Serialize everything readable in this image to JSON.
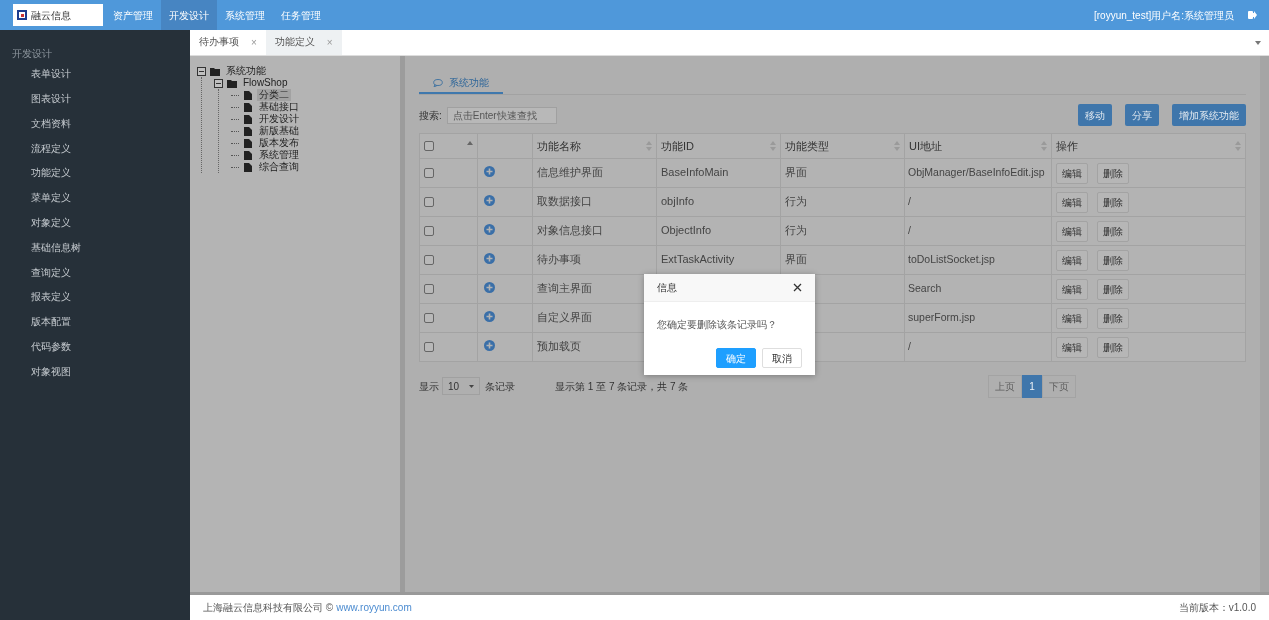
{
  "header": {
    "logo_text": "融云信息",
    "nav": [
      {
        "label": "资产管理",
        "selected": false
      },
      {
        "label": "开发设计",
        "selected": true
      },
      {
        "label": "系统管理",
        "selected": false
      },
      {
        "label": "任务管理",
        "selected": false
      }
    ],
    "user": "[royyun_test]用户名:系统管理员"
  },
  "sidebar": {
    "heading": "开发设计",
    "items": [
      {
        "label": "表单设计"
      },
      {
        "label": "图表设计"
      },
      {
        "label": "文档资料"
      },
      {
        "label": "流程定义"
      },
      {
        "label": "功能定义"
      },
      {
        "label": "菜单定义"
      },
      {
        "label": "对象定义"
      },
      {
        "label": "基础信息树"
      },
      {
        "label": "查询定义"
      },
      {
        "label": "报表定义"
      },
      {
        "label": "版本配置"
      },
      {
        "label": "代码参数"
      },
      {
        "label": "对象视图"
      }
    ]
  },
  "tabs": [
    {
      "label": "待办事项",
      "close": "×",
      "selected": true
    },
    {
      "label": "功能定义",
      "close": "×",
      "selected": false
    }
  ],
  "tree": [
    {
      "label": "系统功能",
      "expanded": true,
      "selected": false,
      "children": [
        {
          "label": "FlowShop",
          "expanded": true,
          "selected": false,
          "children": [
            {
              "label": "分类二",
              "selected": true
            },
            {
              "label": "基础接口",
              "selected": false
            },
            {
              "label": "开发设计",
              "selected": false
            },
            {
              "label": "新版基础",
              "selected": false
            },
            {
              "label": "版本发布",
              "selected": false
            },
            {
              "label": "系统管理",
              "selected": false
            },
            {
              "label": "综合查询",
              "selected": false
            }
          ]
        }
      ]
    }
  ],
  "panel": {
    "tab": "系统功能",
    "search_label": "搜索:",
    "search_placeholder": "点击Enter快速查找",
    "buttons": [
      "移动",
      "分享",
      "增加系统功能"
    ]
  },
  "table": {
    "all_checked": false,
    "columns": [
      "功能名称",
      "功能ID",
      "功能类型",
      "UI地址",
      "操作"
    ],
    "rows": [
      {
        "name": "信息维护界面",
        "id": "BaseInfoMain",
        "type": "界面",
        "url": "ObjManager/BaseInfoEdit.jsp",
        "checked": false,
        "actions": [
          "编辑",
          "删除"
        ]
      },
      {
        "name": "取数据接口",
        "id": "objInfo",
        "type": "行为",
        "url": "/",
        "checked": false,
        "actions": [
          "编辑",
          "删除"
        ]
      },
      {
        "name": "对象信息接口",
        "id": "ObjectInfo",
        "type": "行为",
        "url": "/",
        "checked": false,
        "actions": [
          "编辑",
          "删除"
        ]
      },
      {
        "name": "待办事项",
        "id": "ExtTaskActivity",
        "type": "界面",
        "url": "toDoListSocket.jsp",
        "checked": false,
        "actions": [
          "编辑",
          "删除"
        ]
      },
      {
        "name": "查询主界面",
        "url": "Search",
        "checked": false,
        "actions": [
          "编辑",
          "删除"
        ]
      },
      {
        "name": "自定义界面",
        "url": "superForm.jsp",
        "checked": false,
        "actions": [
          "编辑",
          "删除"
        ]
      },
      {
        "name": "预加载页",
        "url": "/",
        "checked": false,
        "actions": [
          "编辑",
          "删除"
        ]
      }
    ]
  },
  "length_menu": {
    "prefix": "显示",
    "value": "10",
    "suffix": "条记录"
  },
  "info": "显示第 1 至 7 条记录，共 7 条",
  "pagination": [
    {
      "label": "上页",
      "disabled": true,
      "selected": false
    },
    {
      "label": "1",
      "disabled": false,
      "selected": true
    },
    {
      "label": "下页",
      "disabled": true,
      "selected": false
    }
  ],
  "dialog": {
    "title": "信息",
    "message": "您确定要删除该条记录吗？",
    "buttons": [
      {
        "label": "确定",
        "kind": "primary"
      },
      {
        "label": "取消",
        "kind": "default"
      }
    ]
  },
  "footer": {
    "company": "上海融云信息科技有限公司 ©",
    "link": "www.royyun.com",
    "version": "当前版本：v1.0.0"
  }
}
